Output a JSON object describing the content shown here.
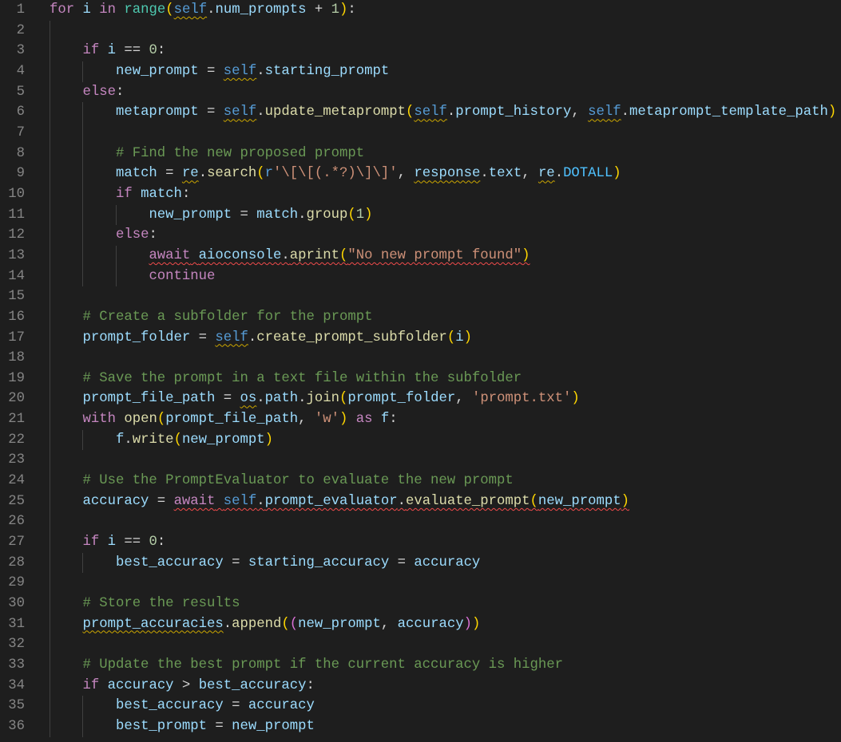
{
  "lines": [
    {
      "n": "1",
      "indent": 0,
      "t": [
        [
          "for",
          "k"
        ],
        [
          " ",
          "w"
        ],
        [
          "i",
          "v"
        ],
        [
          " ",
          "w"
        ],
        [
          "in",
          "k"
        ],
        [
          " ",
          "w"
        ],
        [
          "range",
          "t"
        ],
        [
          "(",
          "b1"
        ],
        [
          "self",
          "s",
          "y"
        ],
        [
          ".",
          "w"
        ],
        [
          "num_prompts",
          "v"
        ],
        [
          " + ",
          "w"
        ],
        [
          "1",
          "n"
        ],
        [
          ")",
          "b1"
        ],
        [
          ":",
          "w"
        ]
      ]
    },
    {
      "n": "2",
      "indent": 1,
      "t": []
    },
    {
      "n": "3",
      "indent": 1,
      "t": [
        [
          "if",
          "k"
        ],
        [
          " ",
          "w"
        ],
        [
          "i",
          "v"
        ],
        [
          " == ",
          "w"
        ],
        [
          "0",
          "n"
        ],
        [
          ":",
          "w"
        ]
      ]
    },
    {
      "n": "4",
      "indent": 2,
      "t": [
        [
          "new_prompt",
          "v"
        ],
        [
          " = ",
          "w"
        ],
        [
          "self",
          "s",
          "y"
        ],
        [
          ".",
          "w"
        ],
        [
          "starting_prompt",
          "v"
        ]
      ]
    },
    {
      "n": "5",
      "indent": 1,
      "t": [
        [
          "else",
          "k"
        ],
        [
          ":",
          "w"
        ]
      ]
    },
    {
      "n": "6",
      "indent": 2,
      "t": [
        [
          "metaprompt",
          "v"
        ],
        [
          " = ",
          "w"
        ],
        [
          "self",
          "s",
          "y"
        ],
        [
          ".",
          "w"
        ],
        [
          "update_metaprompt",
          "f"
        ],
        [
          "(",
          "b1"
        ],
        [
          "self",
          "s",
          "y"
        ],
        [
          ".",
          "w"
        ],
        [
          "prompt_history",
          "v"
        ],
        [
          ", ",
          "w"
        ],
        [
          "self",
          "s",
          "y"
        ],
        [
          ".",
          "w"
        ],
        [
          "metaprompt_template_path",
          "v"
        ],
        [
          ")",
          "b1"
        ]
      ]
    },
    {
      "n": "7",
      "indent": 2,
      "t": []
    },
    {
      "n": "8",
      "indent": 2,
      "t": [
        [
          "# Find the new proposed prompt",
          "c"
        ]
      ]
    },
    {
      "n": "9",
      "indent": 2,
      "t": [
        [
          "match",
          "v"
        ],
        [
          " = ",
          "w"
        ],
        [
          "re",
          "v",
          "y"
        ],
        [
          ".",
          "w"
        ],
        [
          "search",
          "f"
        ],
        [
          "(",
          "b1"
        ],
        [
          "r",
          "s"
        ],
        [
          "'\\[\\[(.*?)\\]\\]'",
          "q"
        ],
        [
          ", ",
          "w"
        ],
        [
          "response",
          "v",
          "y"
        ],
        [
          ".",
          "w"
        ],
        [
          "text",
          "v"
        ],
        [
          ", ",
          "w"
        ],
        [
          "re",
          "v",
          "y"
        ],
        [
          ".",
          "w"
        ],
        [
          "DOTALL",
          "cn"
        ],
        [
          ")",
          "b1"
        ]
      ]
    },
    {
      "n": "10",
      "indent": 2,
      "t": [
        [
          "if",
          "k"
        ],
        [
          " ",
          "w"
        ],
        [
          "match",
          "v"
        ],
        [
          ":",
          "w"
        ]
      ]
    },
    {
      "n": "11",
      "indent": 3,
      "t": [
        [
          "new_prompt",
          "v"
        ],
        [
          " = ",
          "w"
        ],
        [
          "match",
          "v"
        ],
        [
          ".",
          "w"
        ],
        [
          "group",
          "f"
        ],
        [
          "(",
          "b1"
        ],
        [
          "1",
          "n"
        ],
        [
          ")",
          "b1"
        ]
      ]
    },
    {
      "n": "12",
      "indent": 2,
      "t": [
        [
          "else",
          "k"
        ],
        [
          ":",
          "w"
        ]
      ]
    },
    {
      "n": "13",
      "indent": 3,
      "t": [
        [
          "await",
          "k",
          "r"
        ],
        [
          " ",
          "w",
          "r"
        ],
        [
          "aioconsole",
          "v",
          "r"
        ],
        [
          ".",
          "w",
          "r"
        ],
        [
          "aprint",
          "f",
          "r"
        ],
        [
          "(",
          "b1",
          "r"
        ],
        [
          "\"No new prompt found\"",
          "q",
          "r"
        ],
        [
          ")",
          "b1",
          "r"
        ]
      ]
    },
    {
      "n": "14",
      "indent": 3,
      "t": [
        [
          "continue",
          "k"
        ]
      ]
    },
    {
      "n": "15",
      "indent": 1,
      "t": []
    },
    {
      "n": "16",
      "indent": 1,
      "t": [
        [
          "# Create a subfolder for the prompt",
          "c"
        ]
      ]
    },
    {
      "n": "17",
      "indent": 1,
      "t": [
        [
          "prompt_folder",
          "v"
        ],
        [
          " = ",
          "w"
        ],
        [
          "self",
          "s",
          "y"
        ],
        [
          ".",
          "w"
        ],
        [
          "create_prompt_subfolder",
          "f"
        ],
        [
          "(",
          "b1"
        ],
        [
          "i",
          "v"
        ],
        [
          ")",
          "b1"
        ]
      ]
    },
    {
      "n": "18",
      "indent": 1,
      "t": []
    },
    {
      "n": "19",
      "indent": 1,
      "t": [
        [
          "# Save the prompt in a text file within the subfolder",
          "c"
        ]
      ]
    },
    {
      "n": "20",
      "indent": 1,
      "t": [
        [
          "prompt_file_path",
          "v"
        ],
        [
          " = ",
          "w"
        ],
        [
          "os",
          "v",
          "y"
        ],
        [
          ".",
          "w"
        ],
        [
          "path",
          "v"
        ],
        [
          ".",
          "w"
        ],
        [
          "join",
          "f"
        ],
        [
          "(",
          "b1"
        ],
        [
          "prompt_folder",
          "v"
        ],
        [
          ", ",
          "w"
        ],
        [
          "'prompt.txt'",
          "q"
        ],
        [
          ")",
          "b1"
        ]
      ]
    },
    {
      "n": "21",
      "indent": 1,
      "t": [
        [
          "with",
          "k"
        ],
        [
          " ",
          "w"
        ],
        [
          "open",
          "f"
        ],
        [
          "(",
          "b1"
        ],
        [
          "prompt_file_path",
          "v"
        ],
        [
          ", ",
          "w"
        ],
        [
          "'w'",
          "q"
        ],
        [
          ")",
          "b1"
        ],
        [
          " ",
          "w"
        ],
        [
          "as",
          "k"
        ],
        [
          " ",
          "w"
        ],
        [
          "f",
          "v"
        ],
        [
          ":",
          "w"
        ]
      ]
    },
    {
      "n": "22",
      "indent": 2,
      "t": [
        [
          "f",
          "v"
        ],
        [
          ".",
          "w"
        ],
        [
          "write",
          "f"
        ],
        [
          "(",
          "b1"
        ],
        [
          "new_prompt",
          "v"
        ],
        [
          ")",
          "b1"
        ]
      ]
    },
    {
      "n": "23",
      "indent": 1,
      "t": []
    },
    {
      "n": "24",
      "indent": 1,
      "t": [
        [
          "# Use the PromptEvaluator to evaluate the new prompt",
          "c"
        ]
      ]
    },
    {
      "n": "25",
      "indent": 1,
      "t": [
        [
          "accuracy",
          "v"
        ],
        [
          " = ",
          "w"
        ],
        [
          "await",
          "k",
          "r"
        ],
        [
          " ",
          "w",
          "r"
        ],
        [
          "self",
          "s",
          "r"
        ],
        [
          ".",
          "w",
          "r"
        ],
        [
          "prompt_evaluator",
          "v",
          "r"
        ],
        [
          ".",
          "w",
          "r"
        ],
        [
          "evaluate_prompt",
          "f",
          "r"
        ],
        [
          "(",
          "b1",
          "r"
        ],
        [
          "new_prompt",
          "v",
          "r"
        ],
        [
          ")",
          "b1",
          "r"
        ]
      ]
    },
    {
      "n": "26",
      "indent": 1,
      "t": []
    },
    {
      "n": "27",
      "indent": 1,
      "t": [
        [
          "if",
          "k"
        ],
        [
          " ",
          "w"
        ],
        [
          "i",
          "v"
        ],
        [
          " == ",
          "w"
        ],
        [
          "0",
          "n"
        ],
        [
          ":",
          "w"
        ]
      ]
    },
    {
      "n": "28",
      "indent": 2,
      "t": [
        [
          "best_accuracy",
          "v"
        ],
        [
          " = ",
          "w"
        ],
        [
          "starting_accuracy",
          "v"
        ],
        [
          " = ",
          "w"
        ],
        [
          "accuracy",
          "v"
        ]
      ]
    },
    {
      "n": "29",
      "indent": 1,
      "t": []
    },
    {
      "n": "30",
      "indent": 1,
      "t": [
        [
          "# Store the results",
          "c"
        ]
      ]
    },
    {
      "n": "31",
      "indent": 1,
      "t": [
        [
          "prompt_accuracies",
          "v",
          "y"
        ],
        [
          ".",
          "w"
        ],
        [
          "append",
          "f"
        ],
        [
          "(",
          "b1"
        ],
        [
          "(",
          "b2"
        ],
        [
          "new_prompt",
          "v"
        ],
        [
          ", ",
          "w"
        ],
        [
          "accuracy",
          "v"
        ],
        [
          ")",
          "b2"
        ],
        [
          ")",
          "b1"
        ]
      ]
    },
    {
      "n": "32",
      "indent": 1,
      "t": []
    },
    {
      "n": "33",
      "indent": 1,
      "t": [
        [
          "# Update the best prompt if the current accuracy is higher",
          "c"
        ]
      ]
    },
    {
      "n": "34",
      "indent": 1,
      "t": [
        [
          "if",
          "k"
        ],
        [
          " ",
          "w"
        ],
        [
          "accuracy",
          "v"
        ],
        [
          " > ",
          "w"
        ],
        [
          "best_accuracy",
          "v"
        ],
        [
          ":",
          "w"
        ]
      ]
    },
    {
      "n": "35",
      "indent": 2,
      "t": [
        [
          "best_accuracy",
          "v"
        ],
        [
          " = ",
          "w"
        ],
        [
          "accuracy",
          "v"
        ]
      ]
    },
    {
      "n": "36",
      "indent": 2,
      "t": [
        [
          "best_prompt",
          "v"
        ],
        [
          " = ",
          "w"
        ],
        [
          "new_prompt",
          "v"
        ]
      ]
    }
  ]
}
